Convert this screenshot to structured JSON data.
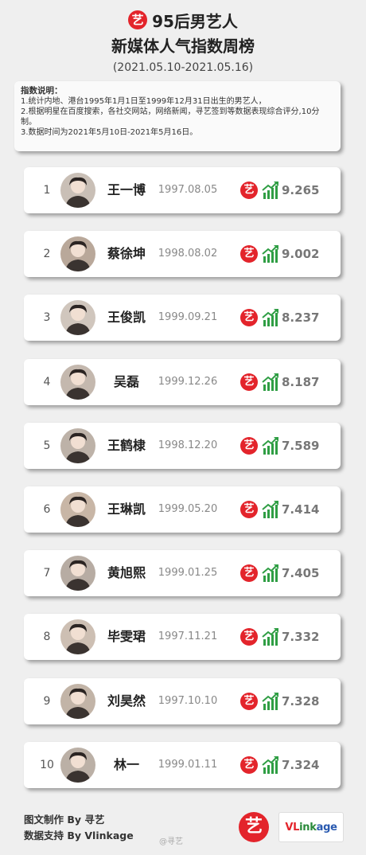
{
  "header": {
    "logo_char": "艺",
    "title_line1": "95后男艺人",
    "title_line2": "新媒体人气指数周榜",
    "date_range": "(2021.05.10-2021.05.16)"
  },
  "note": {
    "title": "指数说明：",
    "lines": [
      "1.统计内地、港台1995年1月1日至1999年12月31日出生的男艺人，",
      "2.根据明星在百度搜索，各社交网站，网络新闻，寻艺签到等数据表现综合评分,10分制。",
      "3.数据时间为2021年5月10日-2021年5月16日。"
    ]
  },
  "ranking": [
    {
      "rank": "1",
      "name": "王一博",
      "birth": "1997.08.05",
      "score": "9.265"
    },
    {
      "rank": "2",
      "name": "蔡徐坤",
      "birth": "1998.08.02",
      "score": "9.002"
    },
    {
      "rank": "3",
      "name": "王俊凯",
      "birth": "1999.09.21",
      "score": "8.237"
    },
    {
      "rank": "4",
      "name": "吴磊",
      "birth": "1999.12.26",
      "score": "8.187"
    },
    {
      "rank": "5",
      "name": "王鹤棣",
      "birth": "1998.12.20",
      "score": "7.589"
    },
    {
      "rank": "6",
      "name": "王琳凯",
      "birth": "1999.05.20",
      "score": "7.414"
    },
    {
      "rank": "7",
      "name": "黄旭熙",
      "birth": "1999.01.25",
      "score": "7.405"
    },
    {
      "rank": "8",
      "name": "毕雯珺",
      "birth": "1997.11.21",
      "score": "7.332"
    },
    {
      "rank": "9",
      "name": "刘昊然",
      "birth": "1997.10.10",
      "score": "7.328"
    },
    {
      "rank": "10",
      "name": "林一",
      "birth": "1999.01.11",
      "score": "7.324"
    }
  ],
  "badge_char": "艺",
  "icons": {
    "badge": "yi-logo-icon",
    "trend": "trend-up-chart-icon"
  },
  "colors": {
    "brand_red": "#e3242b",
    "trend_green": "#2f9e44"
  },
  "footer": {
    "credit_line1": "图文制作 By 寻艺",
    "credit_line2": "数据支持 By Vlinkage",
    "logo_char": "艺",
    "vlinkage_logo": "VLinkage",
    "watermark": "@寻艺"
  }
}
